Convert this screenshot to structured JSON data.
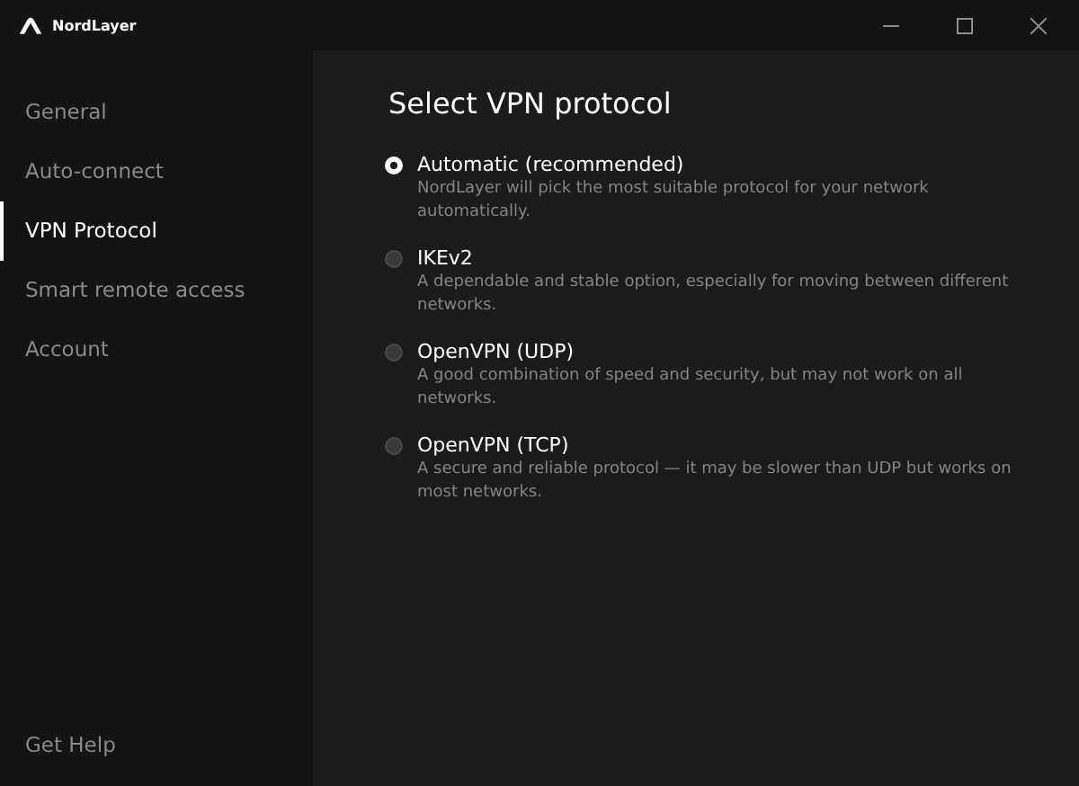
{
  "window": {
    "title": "NordLayer"
  },
  "sidebar": {
    "items": [
      {
        "label": "General",
        "selected": false
      },
      {
        "label": "Auto-connect",
        "selected": false
      },
      {
        "label": "VPN Protocol",
        "selected": true
      },
      {
        "label": "Smart remote access",
        "selected": false
      },
      {
        "label": "Account",
        "selected": false
      }
    ],
    "footer": "Get Help"
  },
  "main": {
    "title": "Select VPN protocol",
    "options": [
      {
        "label": "Automatic (recommended)",
        "description": "NordLayer will pick the most suitable protocol for your network automatically.",
        "selected": true
      },
      {
        "label": "IKEv2",
        "description": "A dependable and stable option, especially for moving between different networks.",
        "selected": false
      },
      {
        "label": "OpenVPN (UDP)",
        "description": "A good combination of speed and security, but may not work on all networks.",
        "selected": false
      },
      {
        "label": "OpenVPN (TCP)",
        "description": "A secure and reliable protocol — it may be slower than UDP but works on most networks.",
        "selected": false
      }
    ]
  }
}
